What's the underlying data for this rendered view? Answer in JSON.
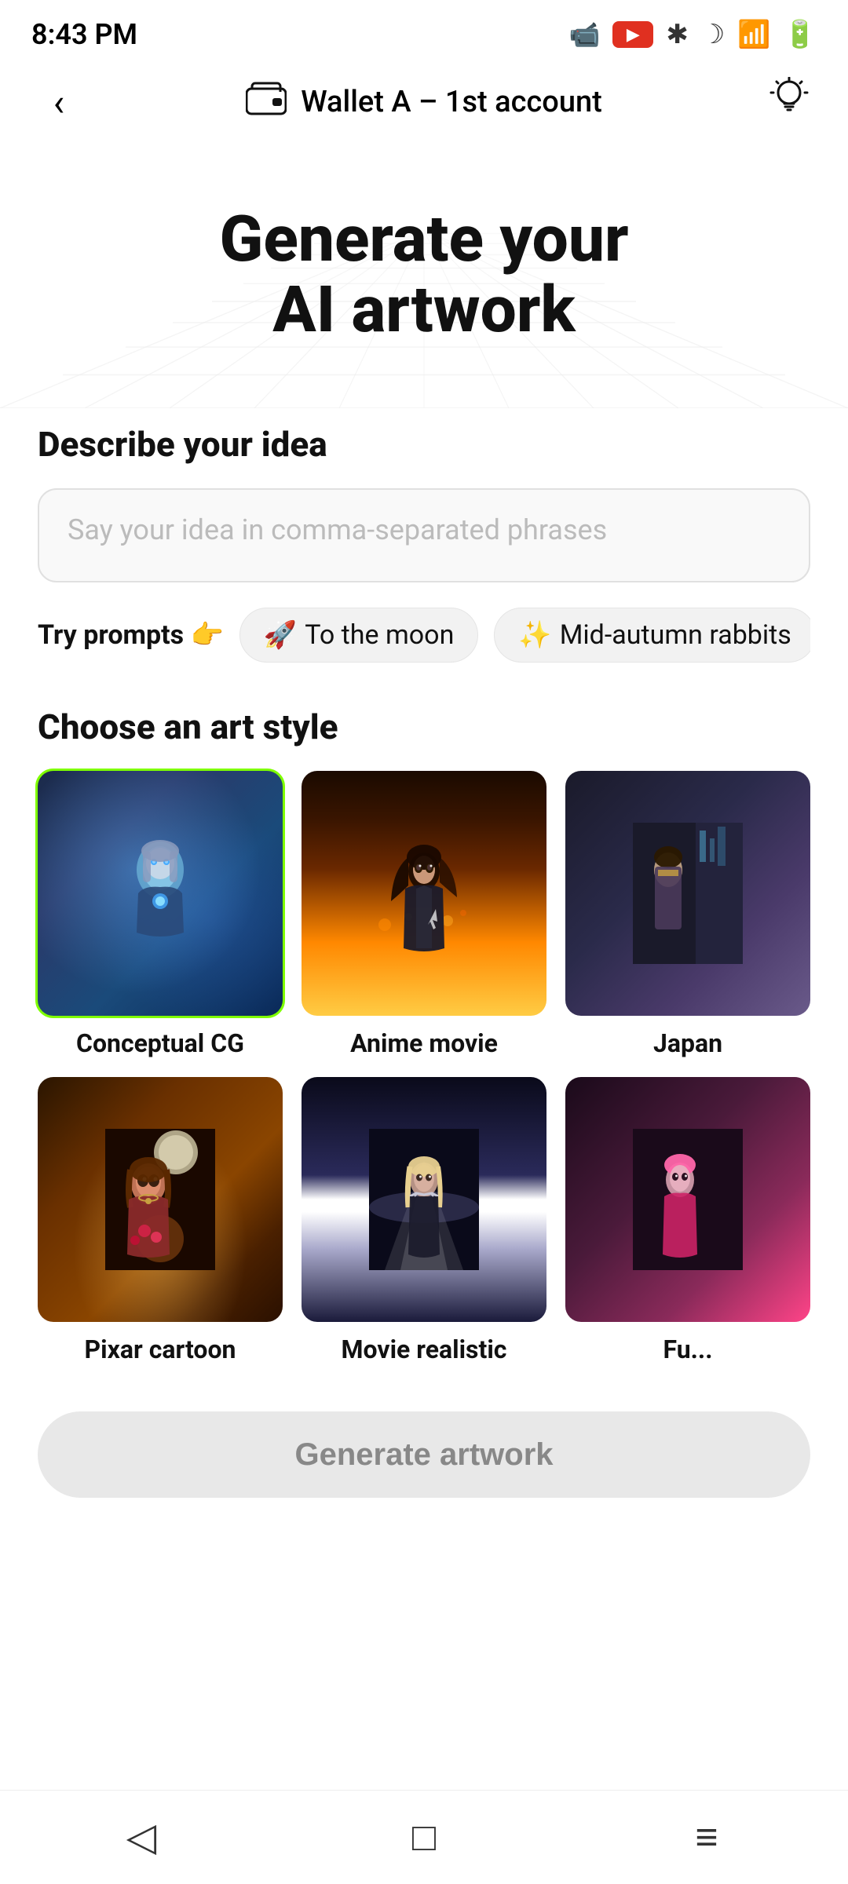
{
  "statusBar": {
    "time": "8:43 PM",
    "cameraIcon": "camera-icon",
    "bluetoothIcon": "bluetooth-icon",
    "moonIcon": "moon-icon",
    "wifiIcon": "wifi-icon",
    "batteryIcon": "battery-icon"
  },
  "header": {
    "backLabel": "‹",
    "walletIcon": "wallet-icon",
    "walletLabel": "Wallet A – 1st account",
    "lightbulbIcon": "lightbulb-icon"
  },
  "hero": {
    "title": "Generate your\nAI artwork"
  },
  "ideaSection": {
    "label": "Describe your idea",
    "placeholder": "Say your idea in comma-separated phrases"
  },
  "prompts": {
    "tryLabel": "Try prompts 👉",
    "chips": [
      {
        "emoji": "🚀",
        "text": "To the moon"
      },
      {
        "emoji": "✨",
        "text": "Mid-autumn rabbits"
      }
    ]
  },
  "artStyleSection": {
    "label": "Choose an art style",
    "styles": [
      {
        "id": "conceptual-cg",
        "label": "Conceptual CG",
        "selected": true
      },
      {
        "id": "anime-movie",
        "label": "Anime movie",
        "selected": false
      },
      {
        "id": "japan",
        "label": "Japan",
        "selected": false
      },
      {
        "id": "pixar-cartoon",
        "label": "Pixar cartoon",
        "selected": false
      },
      {
        "id": "movie-realistic",
        "label": "Movie realistic",
        "selected": false
      },
      {
        "id": "fu",
        "label": "Fu...",
        "selected": false
      }
    ]
  },
  "generateButton": {
    "label": "Generate artwork"
  },
  "bottomNav": {
    "back": "◁",
    "home": "□",
    "menu": "≡"
  }
}
